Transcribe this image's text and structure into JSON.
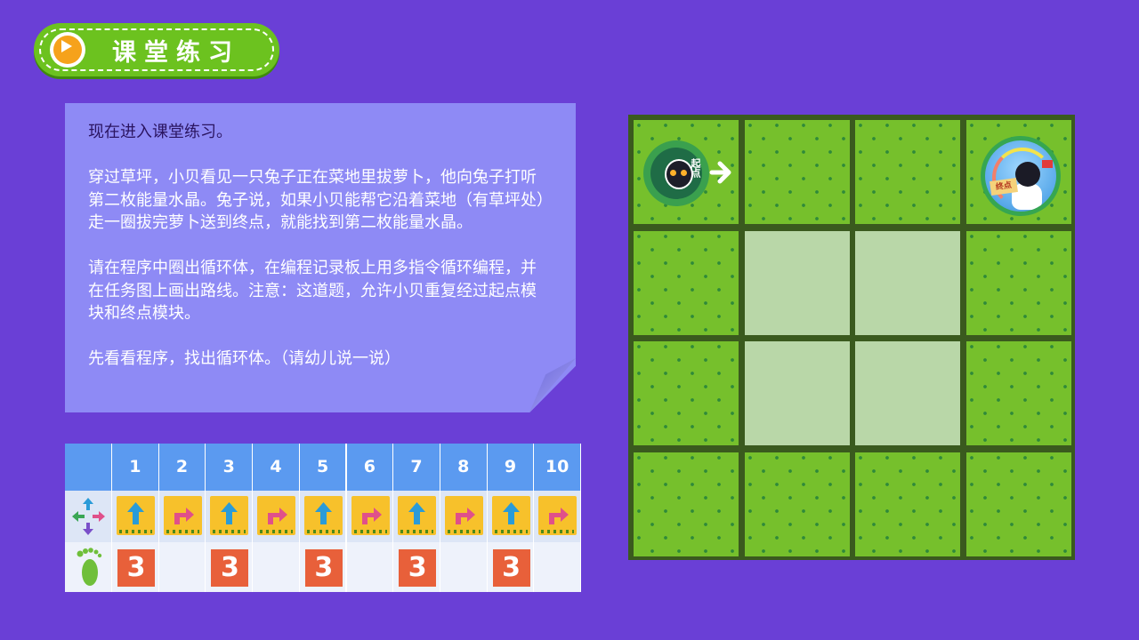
{
  "header": {
    "title": "课堂练习",
    "icon": "play-icon"
  },
  "note": {
    "paragraphs": [
      "现在进入课堂练习。",
      "穿过草坪，小贝看见一只兔子正在菜地里拔萝卜，他向兔子打听第二枚能量水晶。兔子说，如果小贝能帮它沿着菜地（有草坪处）走一圈拔完萝卜送到终点，就能找到第二枚能量水晶。",
      "请在程序中圈出循环体，在编程记录板上用多指令循环编程，并在任务图上画出路线。注意：这道题，允许小贝重复经过起点模块和终点模块。",
      "先看看程序，找出循环体。（请幼儿说一说）"
    ]
  },
  "program": {
    "row_icons": [
      "direction-arrows-icon",
      "footprint-icon"
    ],
    "columns": [
      {
        "num": "1",
        "cmd": "up-arrow-icon",
        "count": "3"
      },
      {
        "num": "2",
        "cmd": "turn-right-arrow-icon",
        "count": ""
      },
      {
        "num": "3",
        "cmd": "up-arrow-icon",
        "count": "3"
      },
      {
        "num": "4",
        "cmd": "turn-right-arrow-icon",
        "count": ""
      },
      {
        "num": "5",
        "cmd": "up-arrow-icon",
        "count": "3"
      },
      {
        "num": "6",
        "cmd": "turn-right-arrow-icon",
        "count": ""
      },
      {
        "num": "7",
        "cmd": "up-arrow-icon",
        "count": "3"
      },
      {
        "num": "8",
        "cmd": "turn-right-arrow-icon",
        "count": ""
      },
      {
        "num": "9",
        "cmd": "up-arrow-icon",
        "count": "3"
      },
      {
        "num": "10",
        "cmd": "turn-right-arrow-icon",
        "count": ""
      }
    ],
    "colors": {
      "up": "#2a9bd8",
      "turn": "#e0508a",
      "tile": "#f7c12b",
      "count_bg": "#e8603a"
    }
  },
  "board": {
    "rows": 4,
    "cols": 4,
    "tiles": [
      [
        "start",
        "grass",
        "grass",
        "end"
      ],
      [
        "grass",
        "plain",
        "plain",
        "grass"
      ],
      [
        "grass",
        "plain",
        "plain",
        "grass"
      ],
      [
        "grass",
        "grass",
        "grass",
        "grass"
      ]
    ],
    "start_label": "起点",
    "end_label": "终点"
  }
}
